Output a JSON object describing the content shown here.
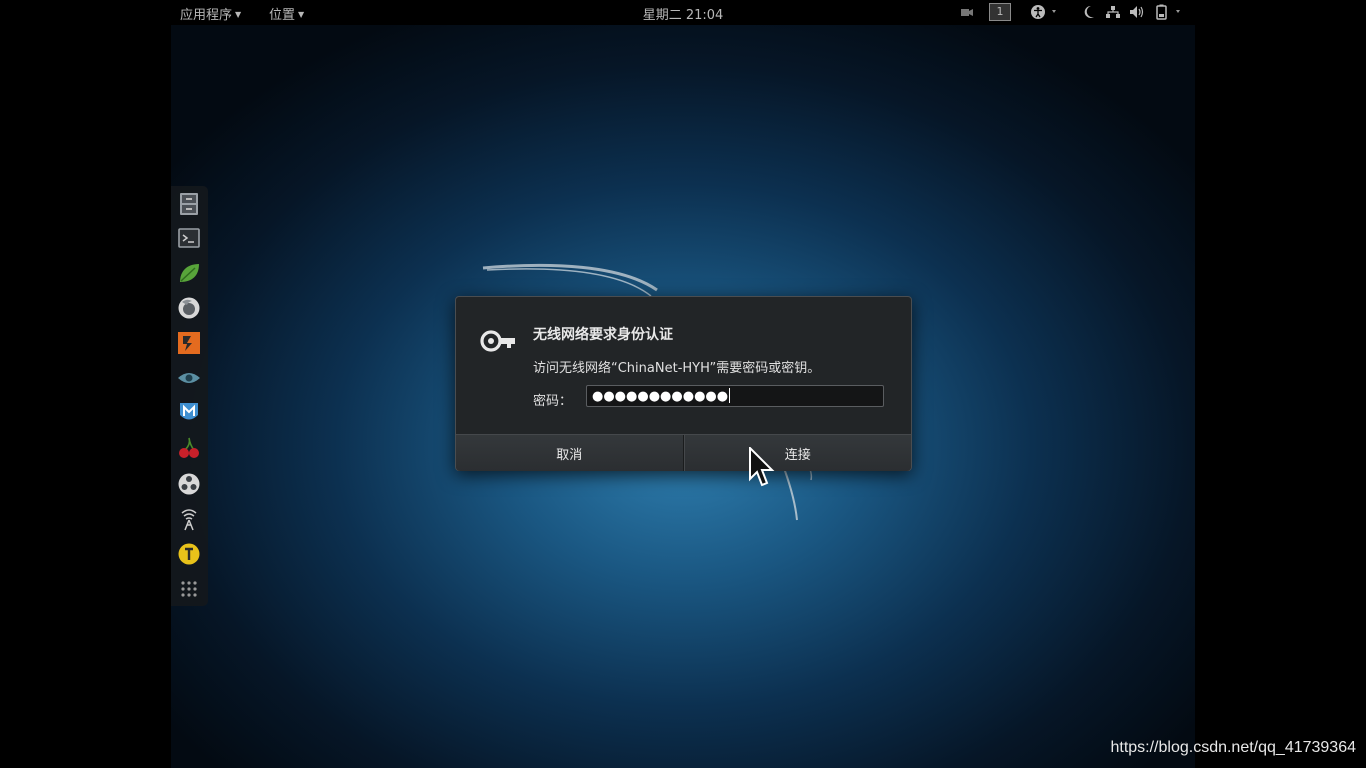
{
  "topbar": {
    "applications_label": "应用程序",
    "places_label": "位置",
    "clock": "星期二 21:04",
    "workspace_number": "1"
  },
  "dock": {
    "items": [
      {
        "icon": "file-manager-icon"
      },
      {
        "icon": "terminal-icon"
      },
      {
        "icon": "leafpad-icon"
      },
      {
        "icon": "firefox-icon"
      },
      {
        "icon": "burpsuite-icon"
      },
      {
        "icon": "eye-icon"
      },
      {
        "icon": "metasploit-icon"
      },
      {
        "icon": "cherry-icon"
      },
      {
        "icon": "faraday-icon"
      },
      {
        "icon": "wifi-tool-icon"
      },
      {
        "icon": "yellow-tool-icon"
      },
      {
        "icon": "show-apps-icon"
      }
    ]
  },
  "dialog": {
    "title": "无线网络要求身份认证",
    "message": "访问无线网络“ChinaNet-HYH”需要密码或密钥。",
    "password_label": "密码：",
    "password_value": "●●●●●●●●●●●●",
    "cancel_label": "取消",
    "connect_label": "连接"
  },
  "watermark": "https://blog.csdn.net/qq_41739364"
}
